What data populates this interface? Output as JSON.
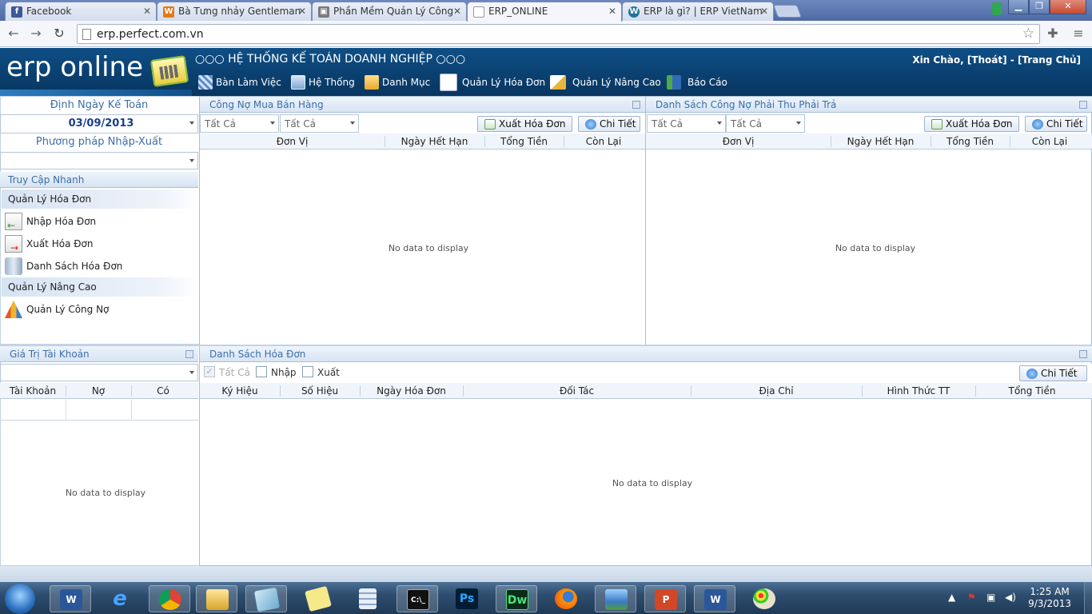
{
  "browser": {
    "tabs": [
      {
        "label": "Facebook",
        "icon": "facebook-icon",
        "color": "#3b5998"
      },
      {
        "label": "Bà Tưng nhảy Gentleman",
        "icon": "w-site-icon",
        "color": "#e27a1c"
      },
      {
        "label": "Phần Mềm Quản Lý Công",
        "icon": "page-icon",
        "color": "#7a7a7a"
      },
      {
        "label": "ERP_ONLINE",
        "icon": "doc-icon",
        "color": "#ffffff"
      },
      {
        "label": "ERP là gì? | ERP VietNam",
        "icon": "wordpress-icon",
        "color": "#21759b"
      }
    ],
    "url": "erp.perfect.com.vn"
  },
  "header": {
    "logo": "erp online",
    "system_title": "○○○ HỆ THỐNG KẾ TOÁN DOANH NGHIỆP ○○○",
    "greeting": "Xin Chào,  [Thoát]  -  [Trang Chủ]",
    "menu": [
      {
        "label": "Bàn Làm Việc",
        "icon": "desktop-grid-icon"
      },
      {
        "label": "Hệ Thống",
        "icon": "computer-icon"
      },
      {
        "label": "Danh Mục",
        "icon": "folder-icon"
      },
      {
        "label": "Quản Lý Hóa Đơn",
        "icon": "invoice-icon"
      },
      {
        "label": "Quản Lý Nâng Cao",
        "icon": "edit-icon"
      },
      {
        "label": "Báo Cáo",
        "icon": "report-icon"
      }
    ]
  },
  "left": {
    "date_label": "Định Ngày Kế Toán",
    "date_value": "03/09/2013",
    "method_label": "Phương pháp Nhập-Xuất",
    "method_value": "",
    "quick_access": {
      "title": "Truy Cập Nhanh",
      "groups": [
        {
          "label": "Quản Lý Hóa Đơn",
          "items": [
            "Nhập Hóa Đơn",
            "Xuất Hóa Đơn",
            "Danh Sách Hóa Đơn"
          ]
        },
        {
          "label": "Quản Lý Nâng Cao",
          "items": [
            "Quản Lý Công Nợ"
          ]
        }
      ]
    },
    "account_value": {
      "title": "Giá Trị Tài Khoản",
      "columns": [
        "Tài Khoản",
        "Nợ",
        "Có"
      ],
      "empty_text": "No data to display"
    }
  },
  "debt_panel": {
    "title": "Công Nợ Mua Bán Hàng",
    "filter1": "Tất Cả",
    "filter2": "Tất Cả",
    "export_label": "Xuất Hóa Đơn",
    "detail_label": "Chi Tiết",
    "columns": [
      "Đơn Vị",
      "Ngày Hết Hạn",
      "Tổng Tiền",
      "Còn Lại"
    ],
    "empty_text": "No data to display"
  },
  "receivable_panel": {
    "title": "Danh Sách Công Nợ Phải Thu Phải Trả",
    "filter1": "Tất Cả",
    "filter2": "Tất Cả",
    "export_label": "Xuất Hóa Đơn",
    "detail_label": "Chi Tiết",
    "columns": [
      "Đơn Vị",
      "Ngày Hết Hạn",
      "Tổng Tiền",
      "Còn Lại"
    ],
    "empty_text": "No data to display"
  },
  "invoice_panel": {
    "title": "Danh Sách Hóa Đơn",
    "checks": [
      {
        "label": "Tất Cả",
        "checked": true,
        "disabled": true
      },
      {
        "label": "Nhập",
        "checked": false
      },
      {
        "label": "Xuất",
        "checked": false
      }
    ],
    "detail_label": "Chi Tiết",
    "columns": [
      "Ký Hiệu",
      "Số Hiệu",
      "Ngày Hóa Đơn",
      "Đối Tác",
      "Địa Chỉ",
      "Hình Thức TT",
      "Tổng Tiền"
    ],
    "empty_text": "No data to display"
  },
  "taskbar": {
    "apps": [
      "start-orb-icon",
      "word-icon",
      "ie-icon",
      "chrome-icon",
      "explorer-icon",
      "notes-icon",
      "sticky-icon",
      "calculator-icon",
      "cmd-icon",
      "photoshop-icon",
      "dreamweaver-icon",
      "firefox-icon",
      "picture-icon",
      "powerpoint-icon",
      "word-doc-icon",
      "paint-icon"
    ],
    "cmd_label": "C:\\_",
    "ps_label": "Ps",
    "dw_label": "Dw",
    "time": "1:25 AM",
    "date": "9/3/2013"
  }
}
